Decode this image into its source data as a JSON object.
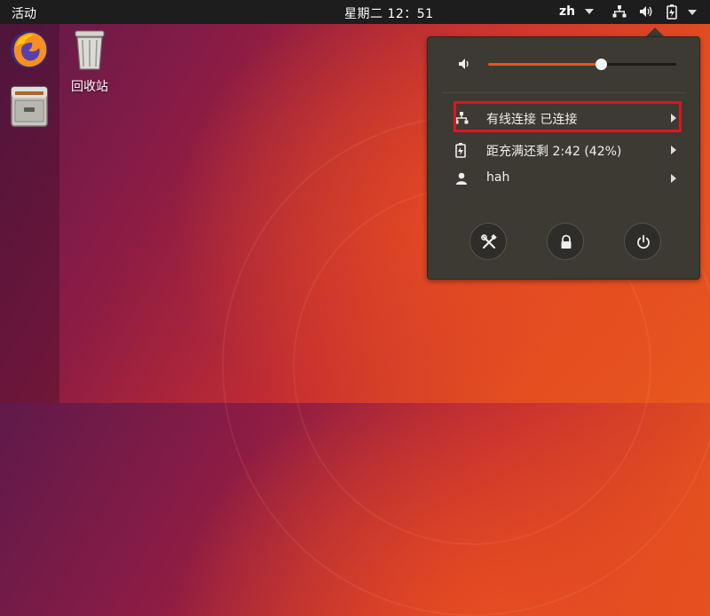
{
  "topbar": {
    "activities": "活动",
    "clock": "星期二 12：51",
    "language": "zh",
    "tray": [
      "network-wired-icon",
      "volume-icon",
      "battery-icon"
    ]
  },
  "dock": {
    "items": [
      "firefox-icon",
      "file-cabinet-icon"
    ]
  },
  "desktop": {
    "trash_label": "回收站"
  },
  "system_menu": {
    "volume_percent": 60,
    "items": [
      {
        "icon": "network-wired-icon",
        "label": "有线连接 已连接"
      },
      {
        "icon": "battery-icon",
        "label": "距充满还剩 2:42 (42%)"
      },
      {
        "icon": "user-icon",
        "label": "hah"
      }
    ],
    "buttons": [
      "settings-tools-icon",
      "lock-icon",
      "power-icon"
    ]
  },
  "colors": {
    "accent": "#e95420",
    "highlight_box": "#e0141e",
    "panel": "#3d3a34",
    "topbar": "#1d1d1d"
  }
}
